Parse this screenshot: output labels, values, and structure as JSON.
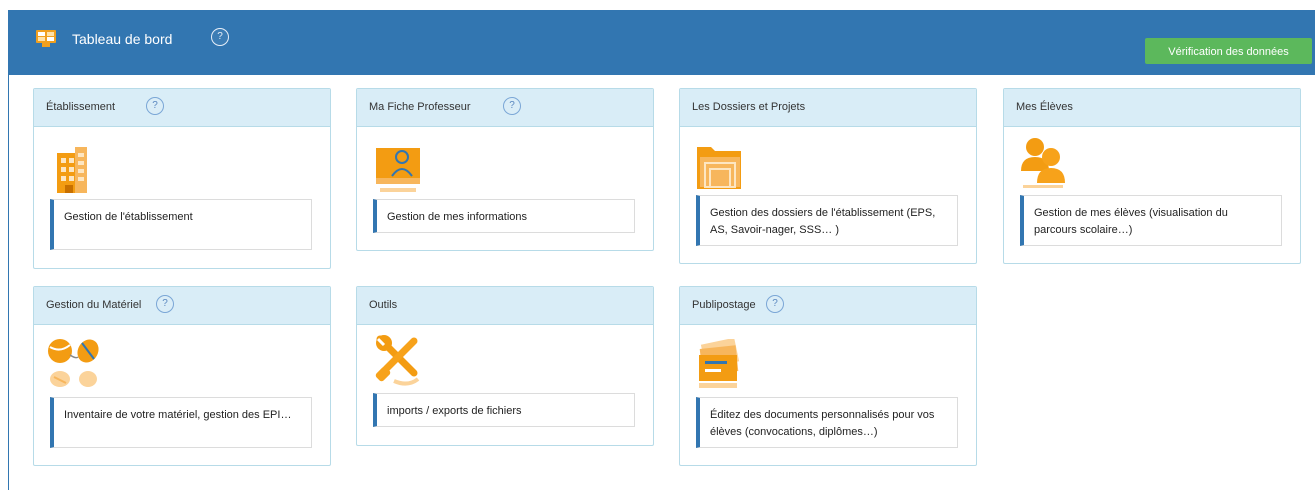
{
  "header": {
    "title": "Tableau de bord",
    "help_symbol": "?",
    "verify_button": "Vérification des données",
    "bar_color": "#3276b1",
    "button_color": "#5cb85c"
  },
  "cards": [
    {
      "title": "Établissement",
      "has_help": true,
      "icon": "building-icon",
      "link": "Gestion de l'établissement"
    },
    {
      "title": "Ma Fiche Professeur",
      "has_help": true,
      "icon": "profile-card-icon",
      "link": "Gestion de mes informations"
    },
    {
      "title": "Les Dossiers et Projets",
      "has_help": false,
      "icon": "folders-icon",
      "link": "Gestion des dossiers de l'établissement (EPS, AS, Savoir-nager, SSS… )"
    },
    {
      "title": "Mes Élèves",
      "has_help": false,
      "icon": "students-icon",
      "link": "Gestion de mes élèves (visualisation du parcours scolaire…)"
    },
    {
      "title": "Gestion du Matériel",
      "has_help": true,
      "icon": "sports-equipment-icon",
      "link": "Inventaire de votre matériel, gestion des EPI…"
    },
    {
      "title": "Outils",
      "has_help": false,
      "icon": "tools-icon",
      "link": "imports / exports de fichiers"
    },
    {
      "title": "Publipostage",
      "has_help": true,
      "icon": "mailing-icon",
      "link": "Éditez des documents personnalisés pour vos élèves (convocations, diplômes…)"
    }
  ]
}
